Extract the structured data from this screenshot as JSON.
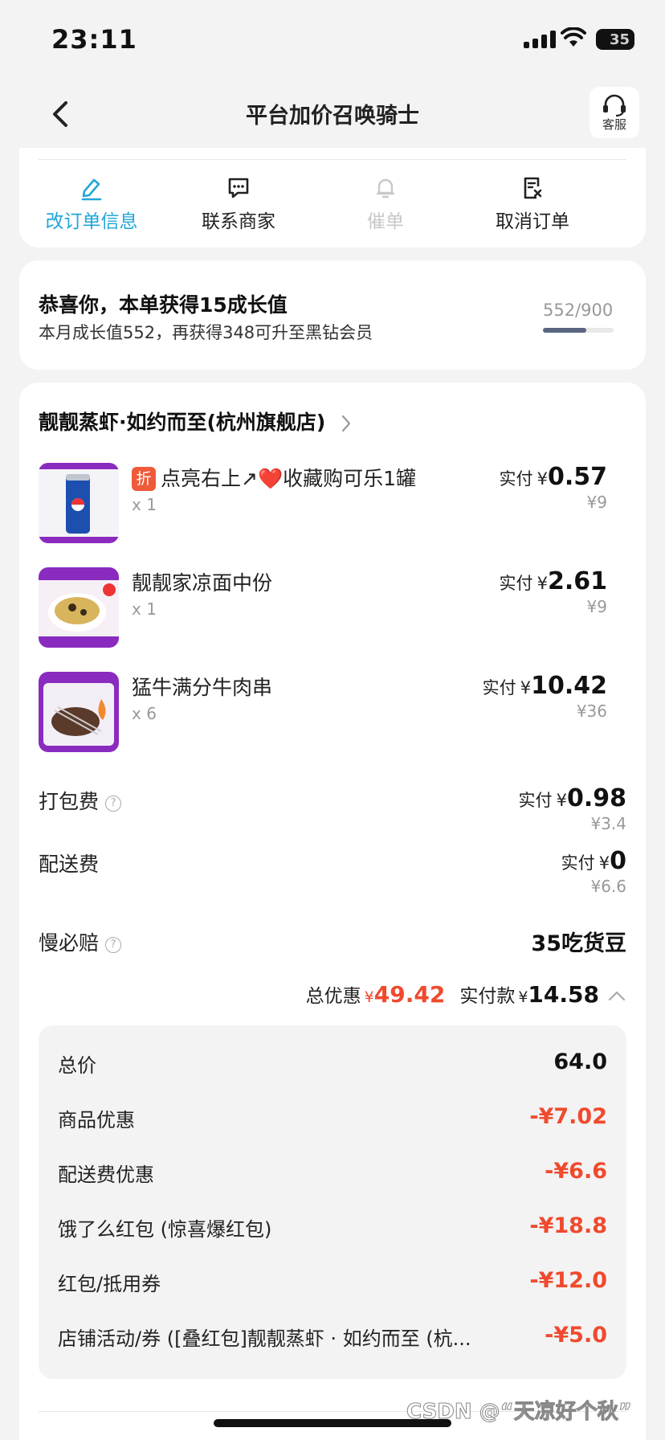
{
  "status_bar": {
    "time": "23:11",
    "battery": "35"
  },
  "header": {
    "title": "平台加价召唤骑士",
    "service_label": "客服"
  },
  "actions": [
    {
      "label": "改订单信息",
      "icon": "edit-icon",
      "color": "#23a6d9"
    },
    {
      "label": "联系商家",
      "icon": "chat-icon",
      "color": "#222222"
    },
    {
      "label": "催单",
      "icon": "bell-icon",
      "color": "#c8c8c8"
    },
    {
      "label": "取消订单",
      "icon": "cancel-order-icon",
      "color": "#222222"
    }
  ],
  "growth": {
    "title": "恭喜你，本单获得15成长值",
    "subtitle": "本月成长值552，再获得348可升至黑钻会员",
    "progress_text": "552/900",
    "progress_fraction": 0.613
  },
  "shop": {
    "name": "靓靓蒸虾·如约而至(杭州旗舰店)"
  },
  "items": [
    {
      "tag": "折",
      "name": "点亮右上↗❤️收藏购可乐1罐",
      "qty": "x 1",
      "paid_label": "实付",
      "currency": "¥",
      "paid": "0.57",
      "original": "¥9"
    },
    {
      "tag": "",
      "name": "靓靓家凉面中份",
      "qty": "x 1",
      "paid_label": "实付",
      "currency": "¥",
      "paid": "2.61",
      "original": "¥9"
    },
    {
      "tag": "",
      "name": "猛牛满分牛肉串",
      "qty": "x 6",
      "paid_label": "实付",
      "currency": "¥",
      "paid": "10.42",
      "original": "¥36"
    }
  ],
  "fees": {
    "packing": {
      "label": "打包费",
      "paid_label": "实付",
      "currency": "¥",
      "paid": "0.98",
      "original": "¥3.4"
    },
    "delivery": {
      "label": "配送费",
      "paid_label": "实付",
      "currency": "¥",
      "paid": "0",
      "original": "¥6.6"
    },
    "late_comp": {
      "label": "慢必赔",
      "value": "35吃货豆"
    }
  },
  "summary": {
    "discount_label": "总优惠",
    "currency": "¥",
    "discount": "49.42",
    "paid_label": "实付款",
    "paid": "14.58"
  },
  "breakdown": [
    {
      "label": "总价",
      "value": "64.0",
      "red": false
    },
    {
      "label": "商品优惠",
      "value": "-¥7.02",
      "red": true
    },
    {
      "label": "配送费优惠",
      "value": "-¥6.6",
      "red": true
    },
    {
      "label": "饿了么红包 (惊喜爆红包)",
      "value": "-¥18.8",
      "red": true
    },
    {
      "label": "红包/抵用券",
      "value": "-¥12.0",
      "red": true
    },
    {
      "label": "店铺活动/券 ([叠红包]靓靓蒸虾 · 如约而至 (杭...",
      "value": "-¥5.0",
      "red": true
    }
  ],
  "watermark": "CSDN @“天凉好个秋”",
  "colors": {
    "accent_blue": "#23a6d9",
    "discount_red": "#ef4a2e",
    "tag_orange": "#ef5a3a"
  }
}
